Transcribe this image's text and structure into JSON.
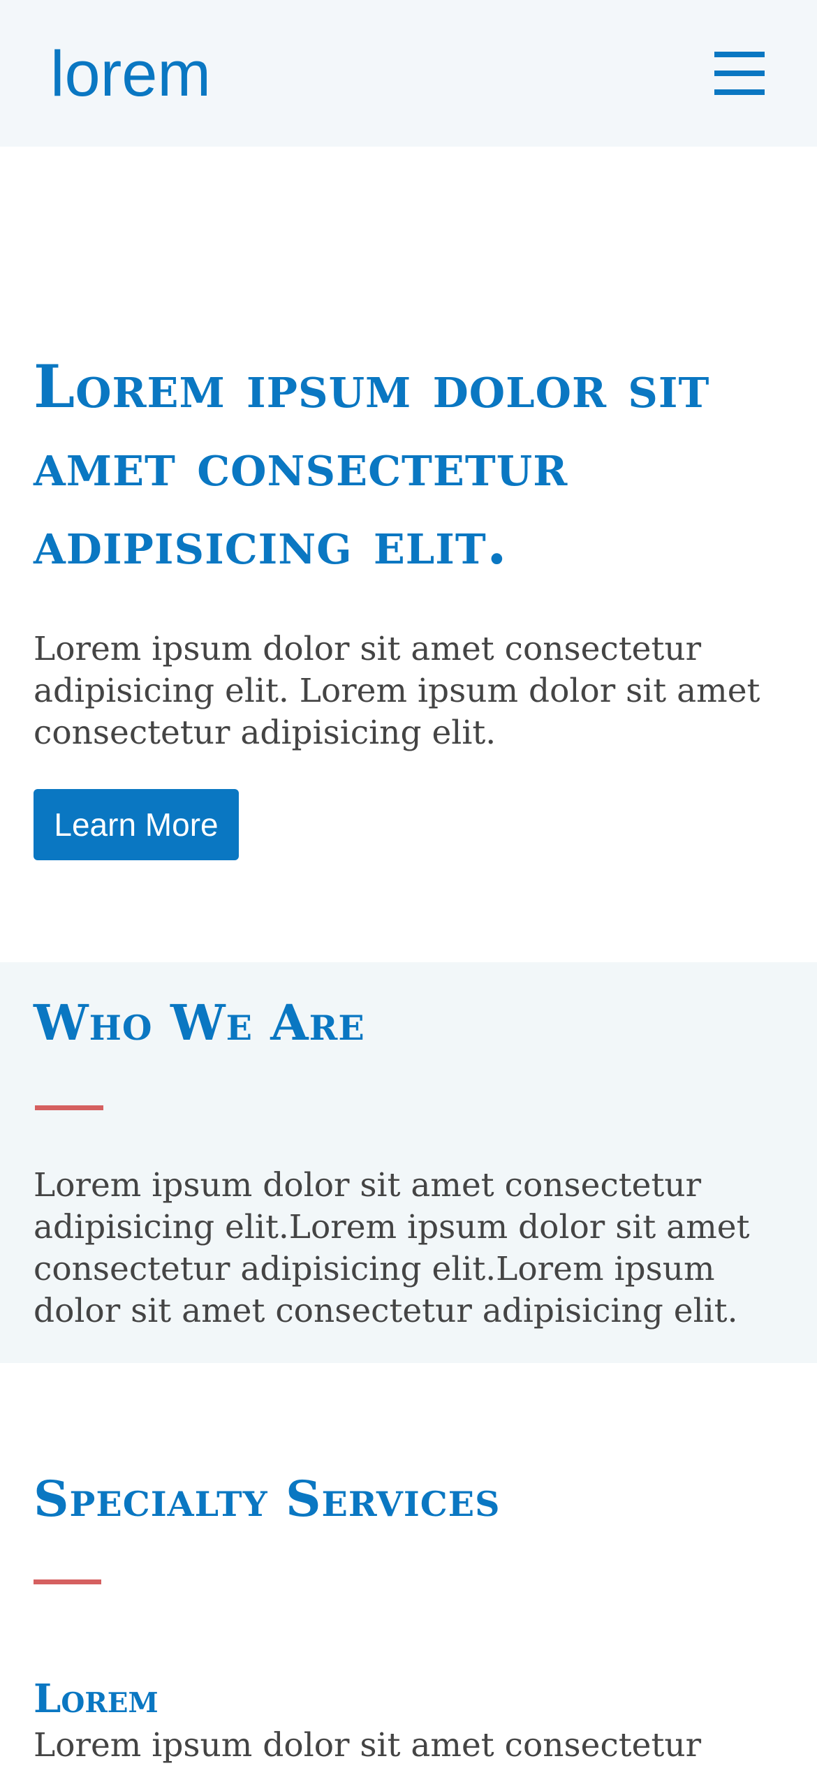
{
  "header": {
    "logo_text": "lorem",
    "menu_icon": "hamburger-menu-icon"
  },
  "hero": {
    "title": "Lorem ipsum dolor sit amet consectetur adipisicing elit.",
    "text": "Lorem ipsum dolor sit amet consectetur adipisicing elit. Lorem ipsum dolor sit amet consectetur adipisicing elit.",
    "button_label": "Learn More"
  },
  "who_we_are": {
    "title": "Who We Are",
    "text": "Lorem ipsum dolor sit amet consectetur adipisicing elit.Lorem ipsum dolor sit amet consectetur adipisicing elit.Lorem ipsum dolor sit amet consectetur adipisicing elit."
  },
  "services": {
    "title": "Specialty Services",
    "items": [
      {
        "title": "Lorem",
        "text": "Lorem ipsum dolor sit amet consectetur"
      }
    ]
  },
  "colors": {
    "brand": "#0a77c2",
    "accent": "#d56060",
    "header_bg": "#f3f7fa",
    "section_bg": "#f2f7f9",
    "body_text": "#444444"
  }
}
